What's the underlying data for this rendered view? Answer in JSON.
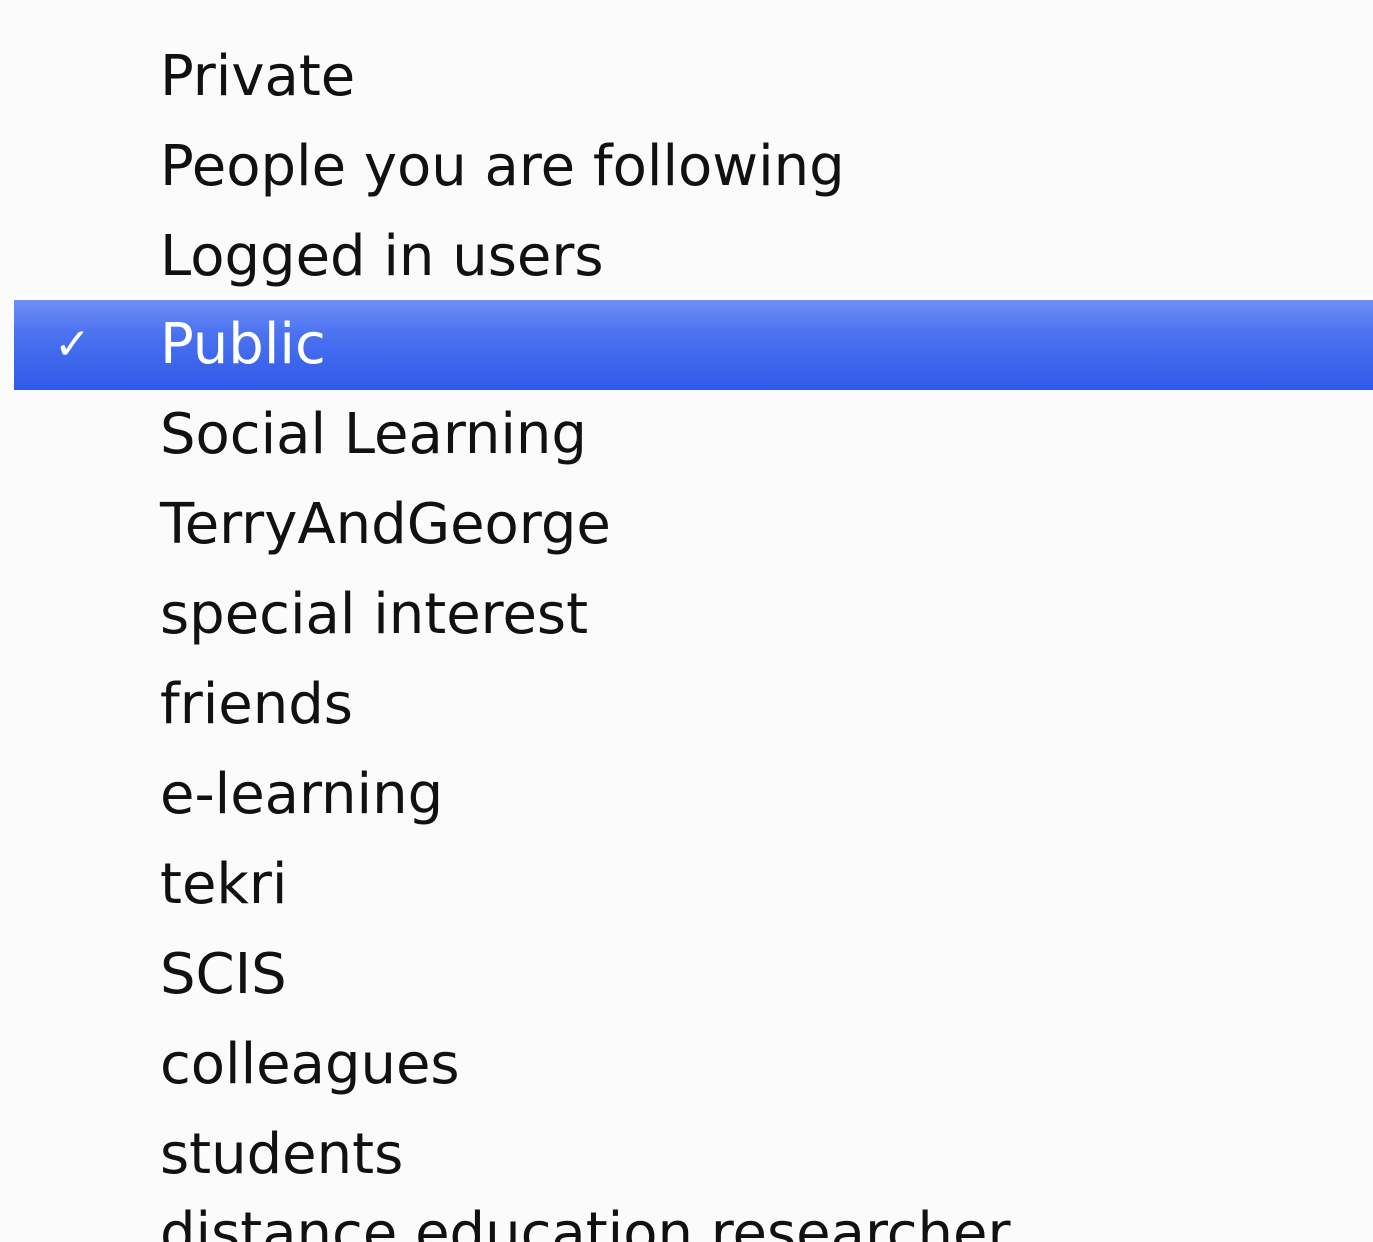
{
  "menu": {
    "items": [
      {
        "label": "Private"
      },
      {
        "label": "People you are following"
      },
      {
        "label": "Logged in users"
      },
      {
        "label": "Public",
        "selected": true
      },
      {
        "label": "Social Learning"
      },
      {
        "label": "TerryAndGeorge"
      },
      {
        "label": "special interest"
      },
      {
        "label": "friends"
      },
      {
        "label": "e-learning"
      },
      {
        "label": "tekri"
      },
      {
        "label": "SCIS"
      },
      {
        "label": "colleagues"
      },
      {
        "label": "students"
      },
      {
        "label": "distance education researcher"
      }
    ],
    "check_glyph": "✓",
    "highlight_color": "#3c64ee"
  }
}
